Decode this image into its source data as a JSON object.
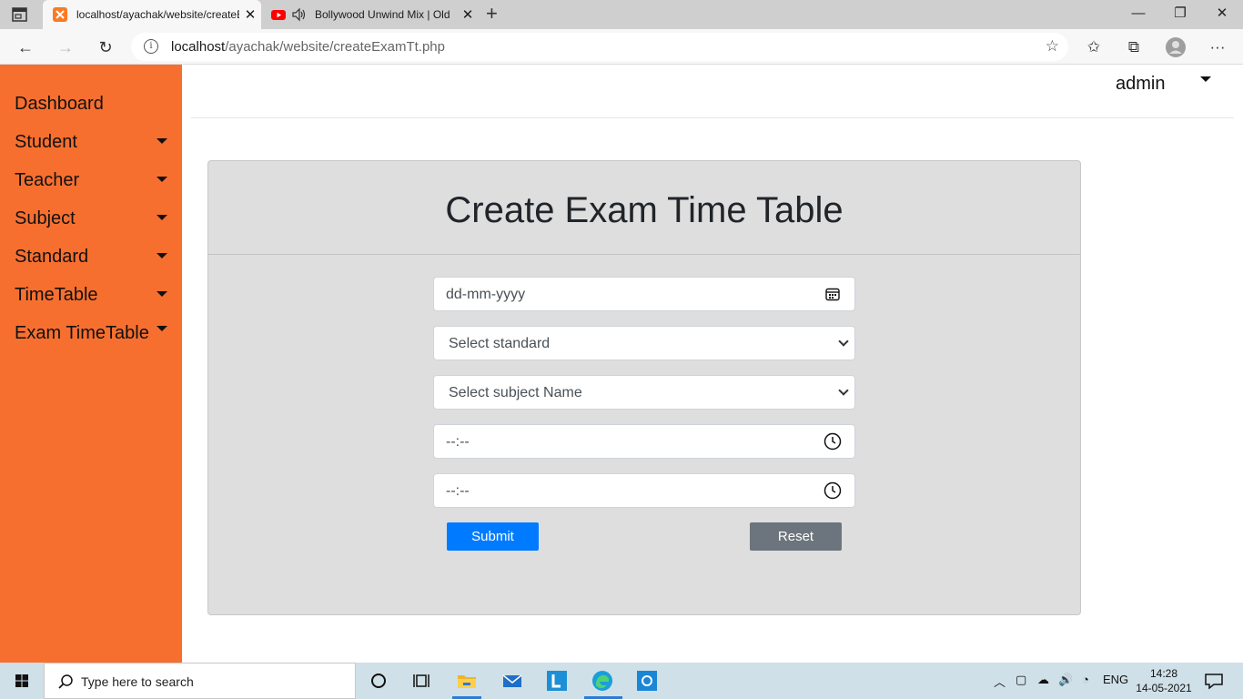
{
  "browser": {
    "tabs": [
      {
        "title": "localhost/ayachak/website/createExamTt.php",
        "active": true
      },
      {
        "title": "Bollywood Unwind Mix | Old",
        "active": false
      }
    ],
    "url_host": "localhost",
    "url_path": "/ayachak/website/createExamTt.php"
  },
  "sidebar": {
    "items": [
      {
        "label": "Dashboard",
        "has_dropdown": false
      },
      {
        "label": "Student",
        "has_dropdown": true
      },
      {
        "label": "Teacher",
        "has_dropdown": true
      },
      {
        "label": "Subject",
        "has_dropdown": true
      },
      {
        "label": "Standard",
        "has_dropdown": true
      },
      {
        "label": "TimeTable",
        "has_dropdown": true
      },
      {
        "label": "Exam TimeTable",
        "has_dropdown": true
      }
    ]
  },
  "topbar": {
    "user": "admin"
  },
  "form": {
    "title": "Create Exam Time Table",
    "date_placeholder": "dd-mm-yyyy",
    "standard_select": "Select standard",
    "subject_select": "Select subject Name",
    "start_time_placeholder": "--:--",
    "end_time_placeholder": "--:--",
    "submit_label": "Submit",
    "reset_label": "Reset"
  },
  "taskbar": {
    "search_placeholder": "Type here to search",
    "language": "ENG",
    "time": "14:28",
    "date": "14-05-2021"
  },
  "colors": {
    "sidebar": "#f76f2f",
    "card": "#dedede",
    "submit": "#007bff",
    "reset": "#6c757d"
  }
}
